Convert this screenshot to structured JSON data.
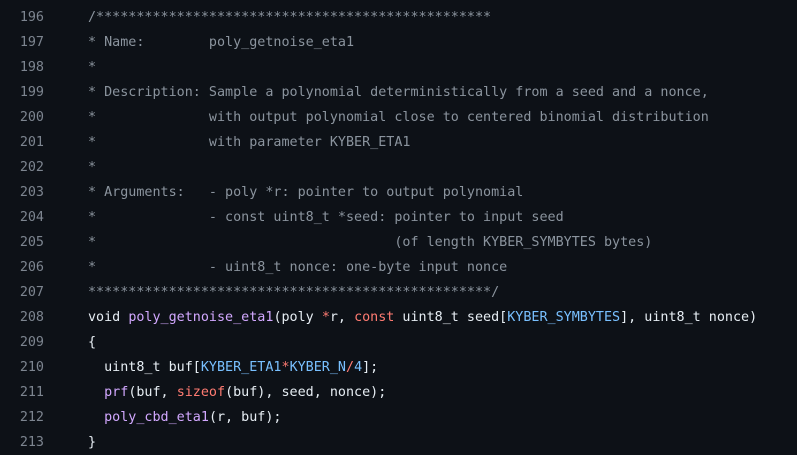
{
  "colors": {
    "background": "#0d1117",
    "line_number": "#7d8590",
    "comment": "#8b949e",
    "plain": "#e6edf3",
    "function": "#d2a8ff",
    "keyword": "#ff7b72",
    "constant": "#79c0ff"
  },
  "lines": [
    {
      "number": "196",
      "tokens": [
        {
          "t": "/*************************************************",
          "k": "comment"
        }
      ]
    },
    {
      "number": "197",
      "tokens": [
        {
          "t": "* Name:        poly_getnoise_eta1",
          "k": "comment"
        }
      ]
    },
    {
      "number": "198",
      "tokens": [
        {
          "t": "*",
          "k": "comment"
        }
      ]
    },
    {
      "number": "199",
      "tokens": [
        {
          "t": "* Description: Sample a polynomial deterministically from a seed and a nonce,",
          "k": "comment"
        }
      ]
    },
    {
      "number": "200",
      "tokens": [
        {
          "t": "*              with output polynomial close to centered binomial distribution",
          "k": "comment"
        }
      ]
    },
    {
      "number": "201",
      "tokens": [
        {
          "t": "*              with parameter KYBER_ETA1",
          "k": "comment"
        }
      ]
    },
    {
      "number": "202",
      "tokens": [
        {
          "t": "*",
          "k": "comment"
        }
      ]
    },
    {
      "number": "203",
      "tokens": [
        {
          "t": "* Arguments:   - poly *r: pointer to output polynomial",
          "k": "comment"
        }
      ]
    },
    {
      "number": "204",
      "tokens": [
        {
          "t": "*              - const uint8_t *seed: pointer to input seed",
          "k": "comment"
        }
      ]
    },
    {
      "number": "205",
      "tokens": [
        {
          "t": "*                                     (of length KYBER_SYMBYTES bytes)",
          "k": "comment"
        }
      ]
    },
    {
      "number": "206",
      "tokens": [
        {
          "t": "*              - uint8_t nonce: one-byte input nonce",
          "k": "comment"
        }
      ]
    },
    {
      "number": "207",
      "tokens": [
        {
          "t": "**************************************************/",
          "k": "comment"
        }
      ]
    },
    {
      "number": "208",
      "tokens": [
        {
          "t": "void ",
          "k": "plain"
        },
        {
          "t": "poly_getnoise_eta1",
          "k": "func"
        },
        {
          "t": "(poly ",
          "k": "plain"
        },
        {
          "t": "*",
          "k": "keyword"
        },
        {
          "t": "r, ",
          "k": "plain"
        },
        {
          "t": "const",
          "k": "keyword"
        },
        {
          "t": " uint8_t seed[",
          "k": "plain"
        },
        {
          "t": "KYBER_SYMBYTES",
          "k": "const"
        },
        {
          "t": "], uint8_t nonce)",
          "k": "plain"
        }
      ]
    },
    {
      "number": "209",
      "tokens": [
        {
          "t": "{",
          "k": "plain"
        }
      ]
    },
    {
      "number": "210",
      "tokens": [
        {
          "t": "  uint8_t buf[",
          "k": "plain"
        },
        {
          "t": "KYBER_ETA1",
          "k": "const"
        },
        {
          "t": "*",
          "k": "keyword"
        },
        {
          "t": "KYBER_N",
          "k": "const"
        },
        {
          "t": "/",
          "k": "keyword"
        },
        {
          "t": "4",
          "k": "const"
        },
        {
          "t": "];",
          "k": "plain"
        }
      ]
    },
    {
      "number": "211",
      "tokens": [
        {
          "t": "  ",
          "k": "plain"
        },
        {
          "t": "prf",
          "k": "func"
        },
        {
          "t": "(buf, ",
          "k": "plain"
        },
        {
          "t": "sizeof",
          "k": "keyword"
        },
        {
          "t": "(buf), seed, nonce);",
          "k": "plain"
        }
      ]
    },
    {
      "number": "212",
      "tokens": [
        {
          "t": "  ",
          "k": "plain"
        },
        {
          "t": "poly_cbd_eta1",
          "k": "func"
        },
        {
          "t": "(r, buf);",
          "k": "plain"
        }
      ]
    },
    {
      "number": "213",
      "tokens": [
        {
          "t": "}",
          "k": "plain"
        }
      ]
    }
  ]
}
